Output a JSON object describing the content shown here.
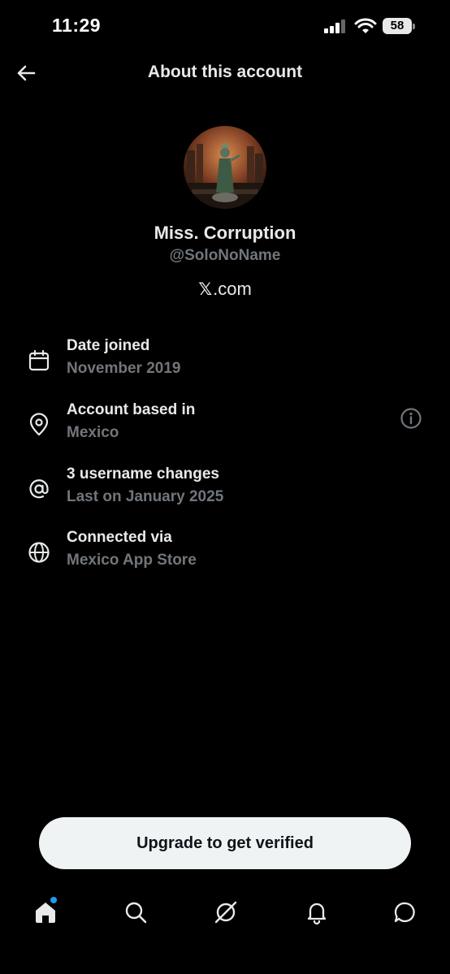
{
  "status_bar": {
    "time": "11:29",
    "battery": "58"
  },
  "header": {
    "title": "About this account"
  },
  "profile": {
    "display_name": "Miss. Corruption",
    "handle": "@SoloNoName",
    "site_x": "𝕏",
    "site_suffix": ".com"
  },
  "info": [
    {
      "title": "Date joined",
      "subtitle": "November 2019",
      "icon": "calendar-icon"
    },
    {
      "title": "Account based in",
      "subtitle": "Mexico",
      "icon": "location-pin-icon"
    },
    {
      "title": "3 username changes",
      "subtitle": "Last on January 2025",
      "icon": "at-sign-icon"
    },
    {
      "title": "Connected via",
      "subtitle": "Mexico App Store",
      "icon": "globe-icon"
    }
  ],
  "upgrade": {
    "label": "Upgrade to get verified"
  },
  "bottom_nav": [
    "home-icon",
    "search-icon",
    "grok-icon",
    "notifications-icon",
    "messages-icon"
  ],
  "colors": {
    "background": "#000000",
    "text": "#e7e9ea",
    "muted": "#71767b",
    "accent": "#1d9bf0",
    "button": "#eff3f4"
  }
}
